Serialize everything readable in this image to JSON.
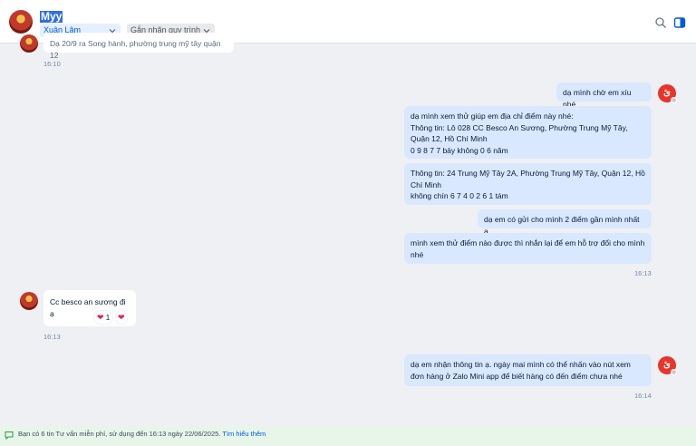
{
  "header": {
    "contact_name": "Myy",
    "assignee": "Xuân Lâm",
    "tag_label": "Gắn nhãn quy trình",
    "icons": [
      "search-icon",
      "sidebar-toggle-icon"
    ]
  },
  "messages": {
    "top_partial": {
      "text": "Dạ 20/9 ra Song hành, phường trung mỹ tây quận 12",
      "time": "16:10"
    },
    "out_group_1": [
      "dạ mình chờ em xíu nhé",
      "dạ mình xem thử giúp em địa chỉ điểm này nhé:",
      "Thông tin: Lô 028 CC Besco An Sương, Phường Trung Mỹ Tây, Quận 12, Hồ Chí Minh",
      "0 9 8 7 7 bảy không 0 6 năm",
      "Thông tin: 24 Trung Mỹ Tây 2A, Phường Trung Mỹ Tây, Quận 12, Hồ Chí Minh",
      "không chín 6 7 4 0 2 6 1 tám",
      "dạ em có gửi cho mình 2 điểm gần mình nhất ạ",
      "mình xem thử điểm nào được thì nhắn lại để em hỗ trợ đổi cho mình nhé"
    ],
    "out_group_1_time": "16:13",
    "in_msg": {
      "text": "Cc besco an sương đi ạ",
      "reaction_count": "1",
      "time": "16:13"
    },
    "out_last": "dạ em nhận thông tin ạ. ngày mai mình có thể nhấn vào nút xem đơn hàng ở Zalo Mini app để biết hàng có đến điểm chưa nhé",
    "out_last_time": "16:14"
  },
  "footer": {
    "text": "Bạn có 6 tin Tư vấn miễn phí, sử dụng đến 16:13 ngày 22/06/2025.",
    "link": "Tìm hiểu thêm"
  },
  "colors": {
    "accent": "#005ae0",
    "outgoing_bubble": "#d9e8ff",
    "background": "#eef0f4"
  }
}
